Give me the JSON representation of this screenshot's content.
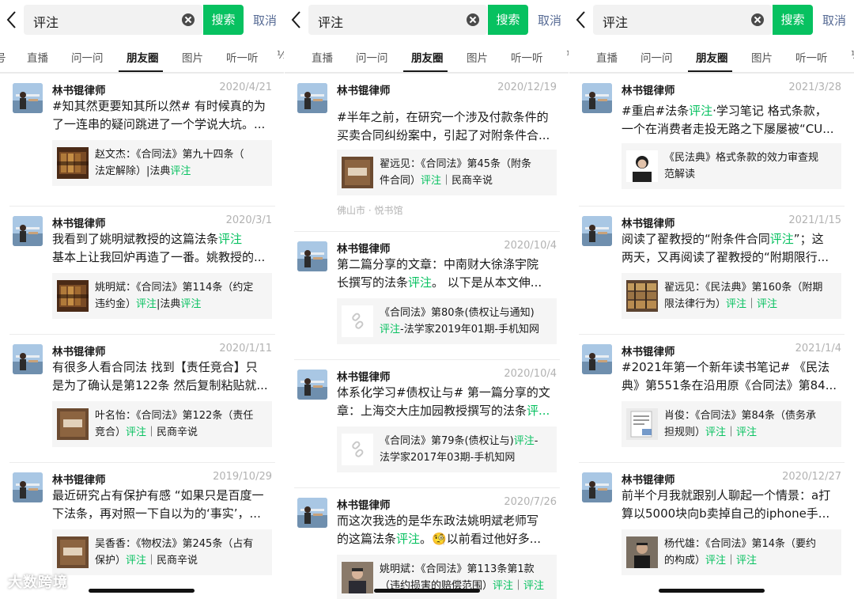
{
  "screens": [
    {
      "search": {
        "value": "评注",
        "button": "搜索",
        "cancel": "取消"
      },
      "tabs": [
        "号",
        "直播",
        "问一问",
        "朋友圈",
        "图片",
        "听一听",
        "⅓"
      ],
      "posts": [
        {
          "author": "林书锟律师",
          "date": "2020/4/21",
          "body_lines": [
            [
              "#知其然更要知其所以然# 有时候真的为",
              ""
            ],
            [
              "了一连串的疑问跳进了一个学说大坑。...",
              ""
            ]
          ],
          "card": {
            "thumb": "book-cover",
            "line1": [
              "赵文杰：《合同法》第九十四条（",
              ""
            ],
            "line2": [
              "法定解除）|法典",
              "评注"
            ]
          }
        },
        {
          "author": "林书锟律师",
          "date": "2020/3/1",
          "body_lines": [
            [
              "我看到了姚明斌教授的这篇法条",
              "评注"
            ],
            [
              "基本上让我回炉再造了一番。姚教授的...",
              ""
            ]
          ],
          "card": {
            "thumb": "book-cover",
            "line1": [
              "姚明斌：《合同法》第114条（约定",
              ""
            ],
            "line2": [
              "违约金）",
              "评注",
              "|法典",
              "评注"
            ]
          }
        },
        {
          "author": "林书锟律师",
          "date": "2020/1/11",
          "body_lines": [
            [
              "有很多人看合同法 找到【责任竞合】只",
              ""
            ],
            [
              "是为了确认是第122条 然后复制粘贴就...",
              ""
            ]
          ],
          "card": {
            "thumb": "minshang",
            "line1": [
              "叶名怡：《合同法》第122条（责任",
              ""
            ],
            "line2": [
              "竞合）",
              "评注",
              "｜民商辛说"
            ]
          }
        },
        {
          "author": "林书锟律师",
          "date": "2019/10/29",
          "body_lines": [
            [
              "最近研究占有保护有感 “如果只是百度一",
              ""
            ],
            [
              "下法条，再对照一下自以为的‘事实’，...",
              ""
            ]
          ],
          "card": {
            "thumb": "minshang",
            "line1": [
              "吴香香：《物权法》第245条（占有",
              ""
            ],
            "line2": [
              "保护）",
              "评注",
              "｜民商辛说"
            ]
          }
        }
      ]
    },
    {
      "search": {
        "value": "评注",
        "button": "搜索",
        "cancel": "取消"
      },
      "tabs": [
        "直播",
        "问一问",
        "朋友圈",
        "图片",
        "听一听",
        "⅓"
      ],
      "posts": [
        {
          "author": "林书锟律师",
          "date": "2020/12/19",
          "body_lines": [
            [
              "#半年之前，在研究一个涉及付款条件的",
              ""
            ],
            [
              "买卖合同纠纷案中，引起了对附条件合...",
              ""
            ]
          ],
          "card": {
            "thumb": "minshang",
            "line1": [
              "翟远见：《合同法》第45条（附条",
              ""
            ],
            "line2": [
              "件合同）",
              "评注",
              "｜民商辛说"
            ]
          },
          "location": "佛山市 · 悦书馆"
        },
        {
          "author": "林书锟律师",
          "date": "2020/10/4",
          "body_lines": [
            [
              "第二篇分享的文章：中南财大徐涤宇院",
              ""
            ],
            [
              "长撰写的法条",
              "评注",
              "。 以下是从本文伸..."
            ]
          ],
          "card": {
            "thumb": "link",
            "line1": [
              "《合同法》第80条(债权让与通知)",
              ""
            ],
            "line2": [
              "",
              "评注",
              "-法学家2019年01期-手机知网"
            ]
          }
        },
        {
          "author": "林书锟律师",
          "date": "2020/10/4",
          "body_lines": [
            [
              "体系化学习#债权让与# 第一篇分享的文",
              ""
            ],
            [
              "章：上海交大庄加园教授撰写的法条",
              "评..."
            ]
          ],
          "card": {
            "thumb": "link",
            "line1": [
              "《合同法》第79条(债权让与)",
              "评注",
              "-"
            ],
            "line2": [
              "法学家2017年03期-手机知网",
              ""
            ]
          }
        },
        {
          "author": "林书锟律师",
          "date": "2020/7/26",
          "body_lines": [
            [
              "而这次我选的是华东政法姚明斌老师写",
              ""
            ],
            [
              "的这篇法条",
              "评注",
              "。🧐以前看过他好多..."
            ]
          ],
          "card": {
            "thumb": "person",
            "line1": [
              "姚明斌：《合同法》第113条第1款",
              ""
            ],
            "line2": [
              "（违约损害的赔偿范围）",
              "评注",
              "｜",
              "评注"
            ]
          }
        }
      ]
    },
    {
      "search": {
        "value": "评注",
        "button": "搜索",
        "cancel": "取消"
      },
      "tabs": [
        "直播",
        "问一问",
        "朋友圈",
        "图片",
        "听一听",
        "⅓"
      ],
      "posts": [
        {
          "author": "林书锟律师",
          "date": "2021/3/28",
          "body_lines": [
            [
              "#重启#法条",
              "评注",
              "·学习笔记 格式条款，"
            ],
            [
              "一个在消费者走投无路之下屡屡被“CU...",
              ""
            ]
          ],
          "card": {
            "thumb": "woman",
            "line1": [
              "《民法典》格式条款的效力审查规",
              ""
            ],
            "line2": [
              "范解读",
              ""
            ]
          }
        },
        {
          "author": "林书锟律师",
          "date": "2021/1/15",
          "body_lines": [
            [
              "阅读了翟教授的“附条件合同",
              "评注",
              "”；这"
            ],
            [
              "两天，又再阅读了翟教授的“附期限行...",
              ""
            ]
          ],
          "card": {
            "thumb": "library",
            "line1": [
              "翟远见：《民法典》第160条（附期",
              ""
            ],
            "line2": [
              "限法律行为）",
              "评注",
              "｜",
              "评注"
            ]
          }
        },
        {
          "author": "林书锟律师",
          "date": "2021/1/4",
          "body_lines": [
            [
              "#2021年第一个新年读书笔记# 《民法",
              ""
            ],
            [
              "典》第551条在沿用原《合同法》第84...",
              ""
            ]
          ],
          "card": {
            "thumb": "paper",
            "line1": [
              "肖俊：《合同法》第84条（债务承",
              ""
            ],
            "line2": [
              "担规则）",
              "评注",
              "｜",
              "评注"
            ]
          }
        },
        {
          "author": "林书锟律师",
          "date": "2020/12/27",
          "body_lines": [
            [
              "前半个月我就跟别人聊起一个情景：a打",
              ""
            ],
            [
              "算以5000块向b卖掉自己的iphone手...",
              ""
            ]
          ],
          "card": {
            "thumb": "man",
            "line1": [
              "杨代雄：《合同法》第14条（要约",
              ""
            ],
            "line2": [
              "的构成）",
              "评注",
              "｜",
              "评注"
            ]
          }
        }
      ]
    }
  ],
  "watermark": "大数跨境",
  "colors": {
    "accent": "#07c160",
    "link": "#576b95",
    "date": "#b2b2b2",
    "card_bg": "#f5f5f5"
  }
}
